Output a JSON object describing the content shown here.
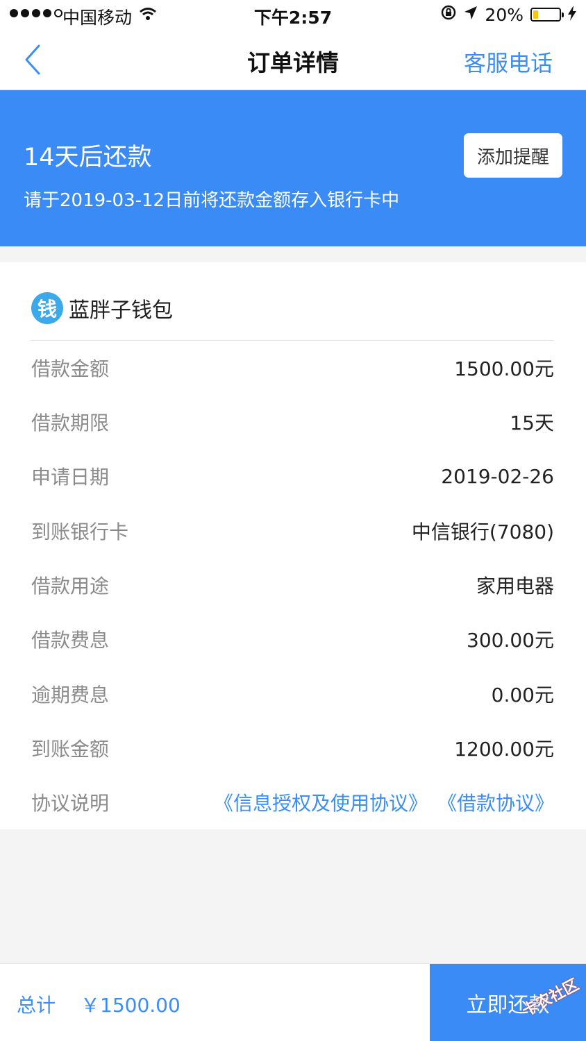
{
  "status_bar": {
    "carrier": "中国移动",
    "time": "下午2:57",
    "battery": "20%",
    "battery_level": 0.2
  },
  "nav": {
    "title": "订单详情",
    "service": "客服电话"
  },
  "banner": {
    "title": "14天后还款",
    "subtitle": "请于2019-03-12日前将还款金额存入银行卡中",
    "remind_button": "添加提醒"
  },
  "card": {
    "icon_char": "钱",
    "title": "蓝胖子钱包",
    "rows": [
      {
        "label": "借款金额",
        "value": "1500.00元"
      },
      {
        "label": "借款期限",
        "value": "15天"
      },
      {
        "label": "申请日期",
        "value": "2019-02-26"
      },
      {
        "label": "到账银行卡",
        "value": "中信银行(7080)"
      },
      {
        "label": "借款用途",
        "value": "家用电器"
      },
      {
        "label": "借款费息",
        "value": "300.00元"
      },
      {
        "label": "逾期费息",
        "value": "0.00元"
      },
      {
        "label": "到账金额",
        "value": "1200.00元"
      }
    ],
    "agreement_label": "协议说明",
    "agreements": [
      "《信息授权及使用协议》",
      "《借款协议》"
    ]
  },
  "bottom": {
    "total_label": "总计",
    "total_amount": "￥1500.00",
    "repay_button": "立即还款"
  },
  "watermark": "卡农社区",
  "colors": {
    "accent": "#3b8bf7",
    "link": "#3a8ef6"
  }
}
